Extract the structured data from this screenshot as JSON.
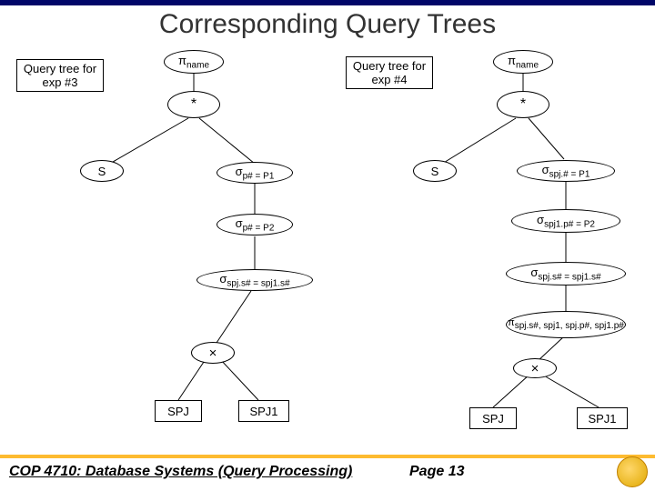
{
  "title": "Corresponding Query Trees",
  "left": {
    "caption1": "Query tree for",
    "caption2": "exp #3",
    "pi_name_prefix": "π",
    "pi_name_sub": "name",
    "star": "*",
    "S": "S",
    "sigma1_prefix": "σ",
    "sigma1_sub": "p# = P1",
    "sigma2_prefix": "σ",
    "sigma2_sub": "p# = P2",
    "sigma3_prefix": "σ",
    "sigma3_sub": "spj.s# = spj1.s#",
    "times": "×",
    "SPJ": "SPJ",
    "SPJ1": "SPJ1"
  },
  "right": {
    "caption1": "Query tree for",
    "caption2": "exp #4",
    "pi_name_prefix": "π",
    "pi_name_sub": "name",
    "star": "*",
    "S": "S",
    "sigma1_prefix": "σ",
    "sigma1_sub": "spj.# = P1",
    "sigma2_prefix": "σ",
    "sigma2_sub": "spj1.p# = P2",
    "sigma3_prefix": "σ",
    "sigma3_sub": "spj.s# = spj1.s#",
    "proj_prefix": "π",
    "proj_sub": "spj.s#, spj1, spj.p#, spj1.p#",
    "times": "×",
    "SPJ": "SPJ",
    "SPJ1": "SPJ1"
  },
  "footer": {
    "course": "COP 4710: Database Systems (Query Processing)",
    "page": "Page 13"
  }
}
